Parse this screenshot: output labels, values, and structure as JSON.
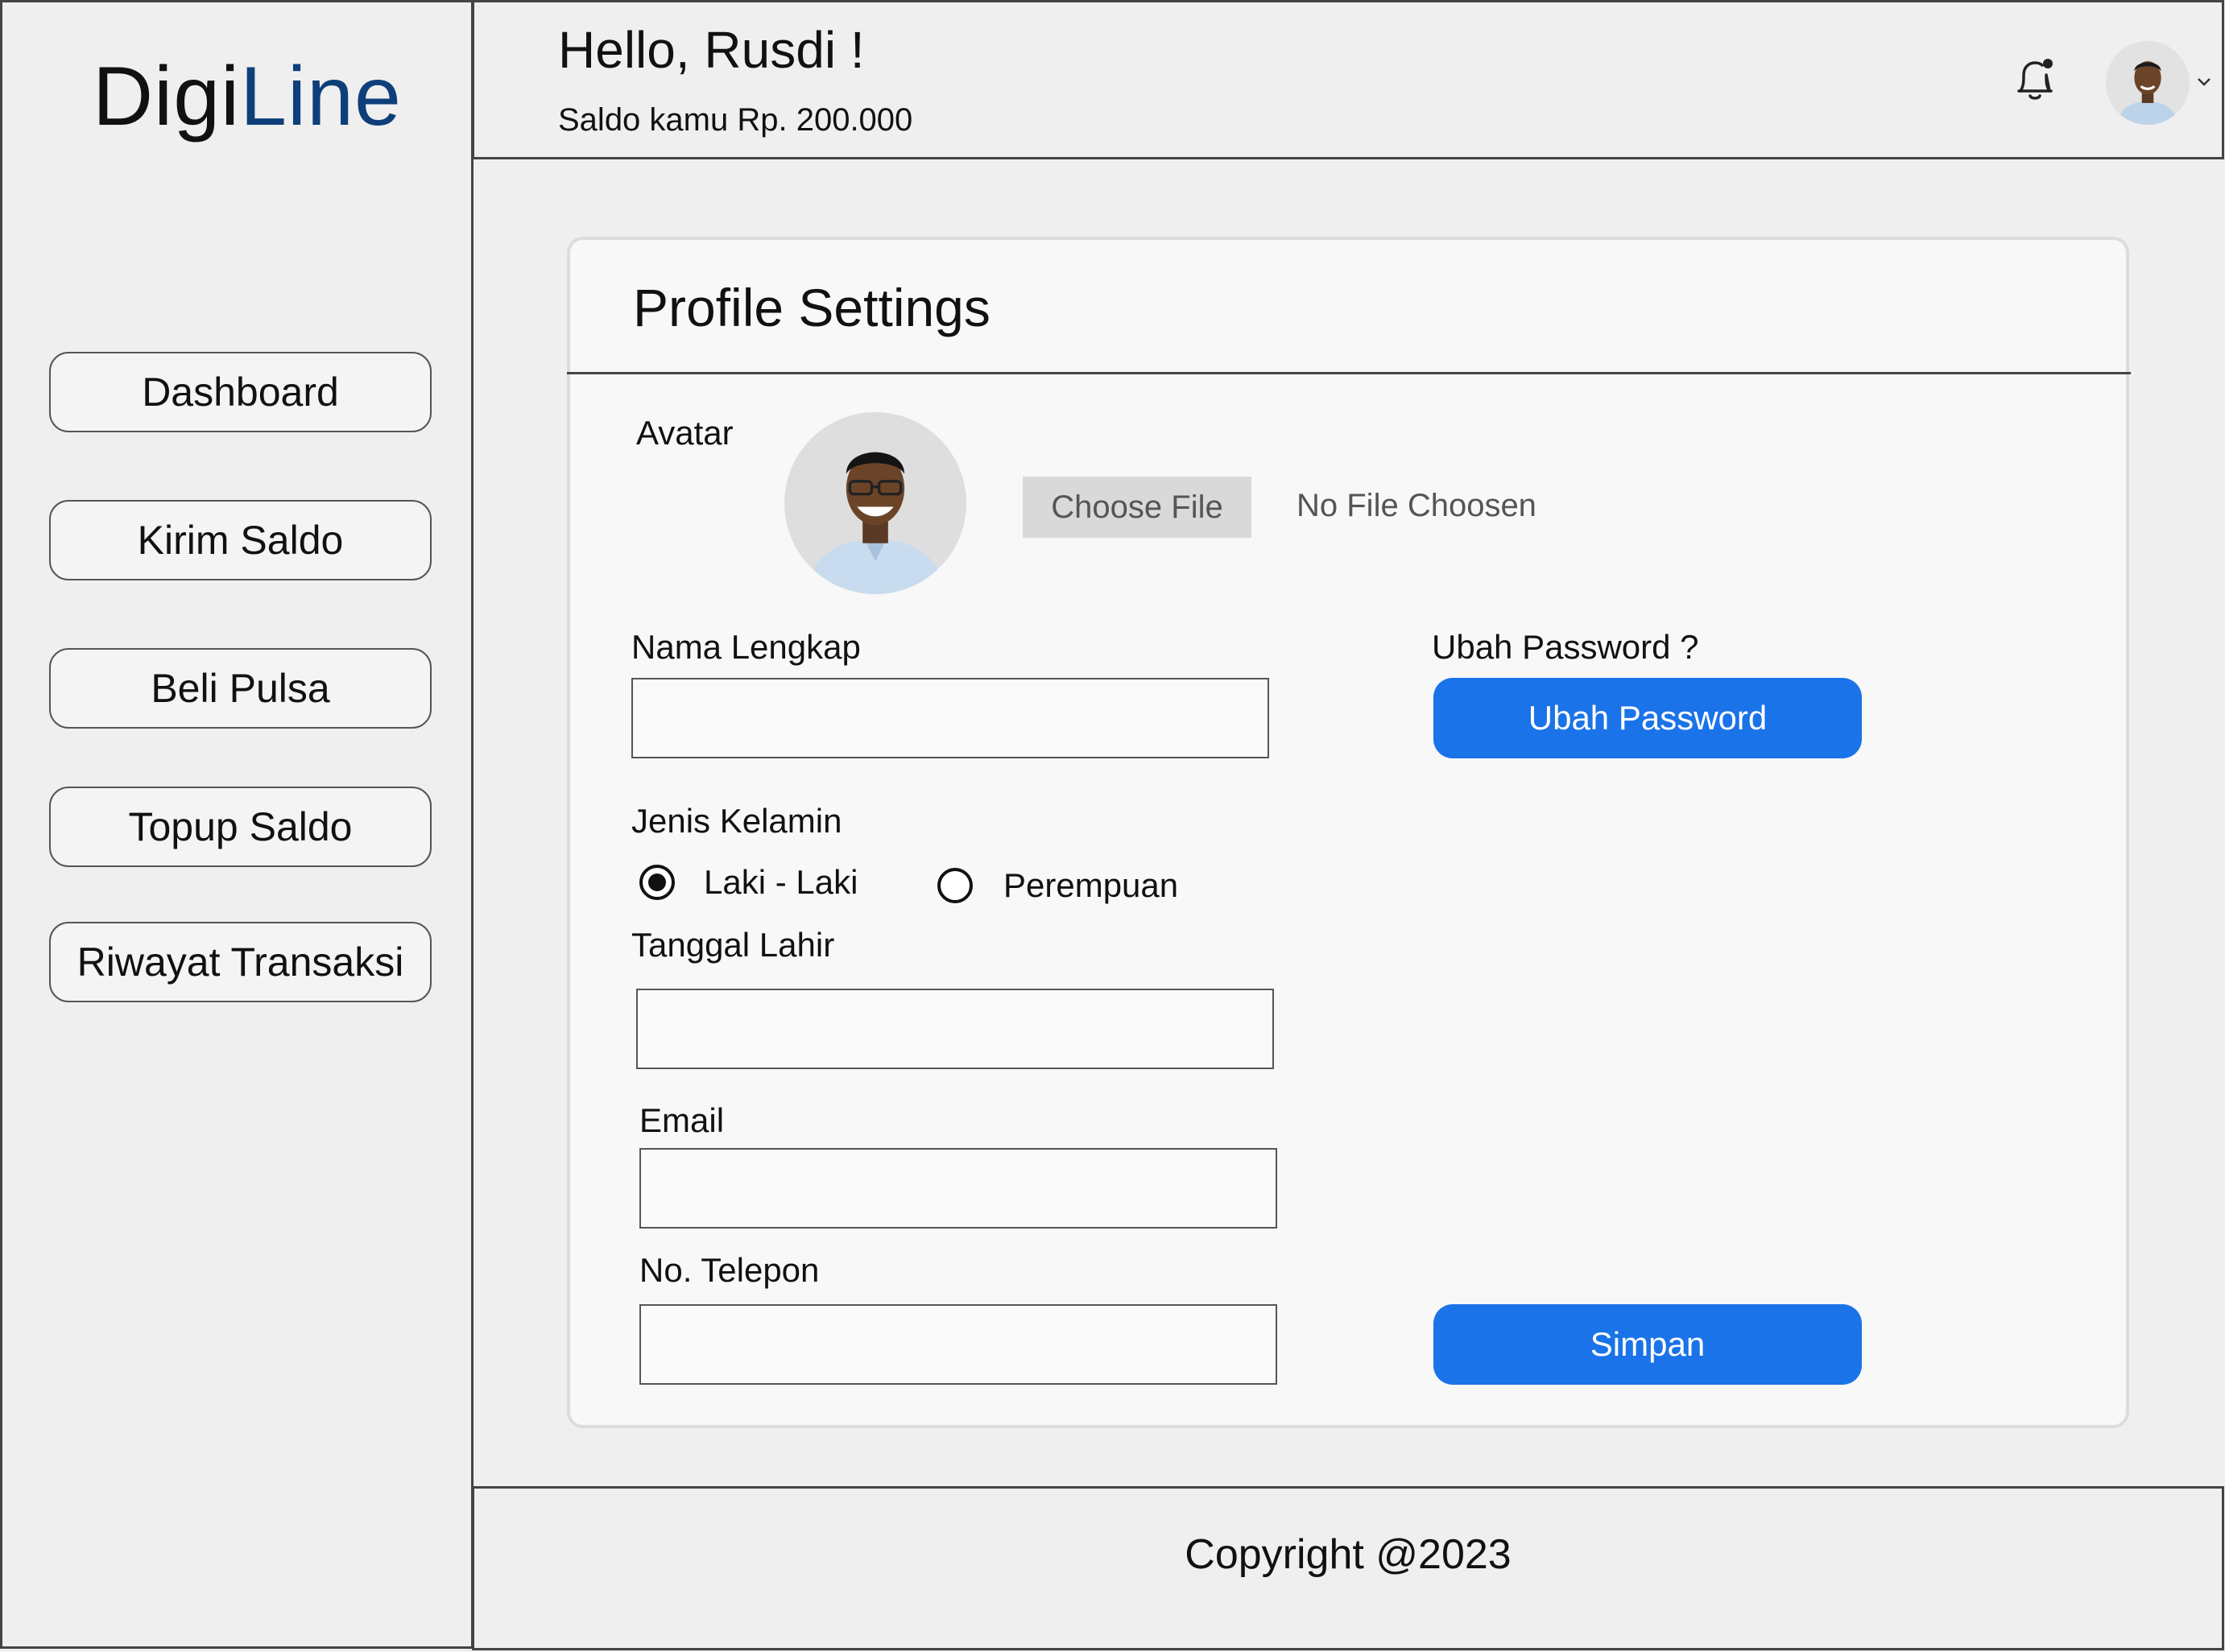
{
  "brand": {
    "part1": "Digi",
    "part2": "Line",
    "accent_color": "#0e3f7a"
  },
  "sidebar": {
    "items": [
      {
        "label": "Dashboard"
      },
      {
        "label": "Kirim Saldo"
      },
      {
        "label": "Beli Pulsa"
      },
      {
        "label": "Topup Saldo"
      },
      {
        "label": "Riwayat Transaksi"
      }
    ]
  },
  "header": {
    "greeting": "Hello, Rusdi !",
    "balance": "Saldo kamu Rp. 200.000",
    "icons": [
      "bell-icon",
      "user-avatar",
      "chevron-down-icon"
    ]
  },
  "profile": {
    "title": "Profile Settings",
    "avatar_label": "Avatar",
    "choose_file": "Choose File",
    "no_file": "No File Choosen",
    "full_name_label": "Nama Lengkap",
    "full_name_value": "",
    "change_password_label": "Ubah Password ?",
    "change_password_button": "Ubah Password",
    "gender_label": "Jenis Kelamin",
    "gender_options": [
      "Laki - Laki",
      "Perempuan"
    ],
    "gender_selected": "Laki - Laki",
    "birthdate_label": "Tanggal Lahir",
    "birthdate_value": "",
    "email_label": "Email",
    "email_value": "",
    "phone_label": "No. Telepon",
    "phone_value": "",
    "save_button": "Simpan",
    "primary_color": "#1a73e8"
  },
  "footer": {
    "copyright": "Copyright @2023"
  }
}
